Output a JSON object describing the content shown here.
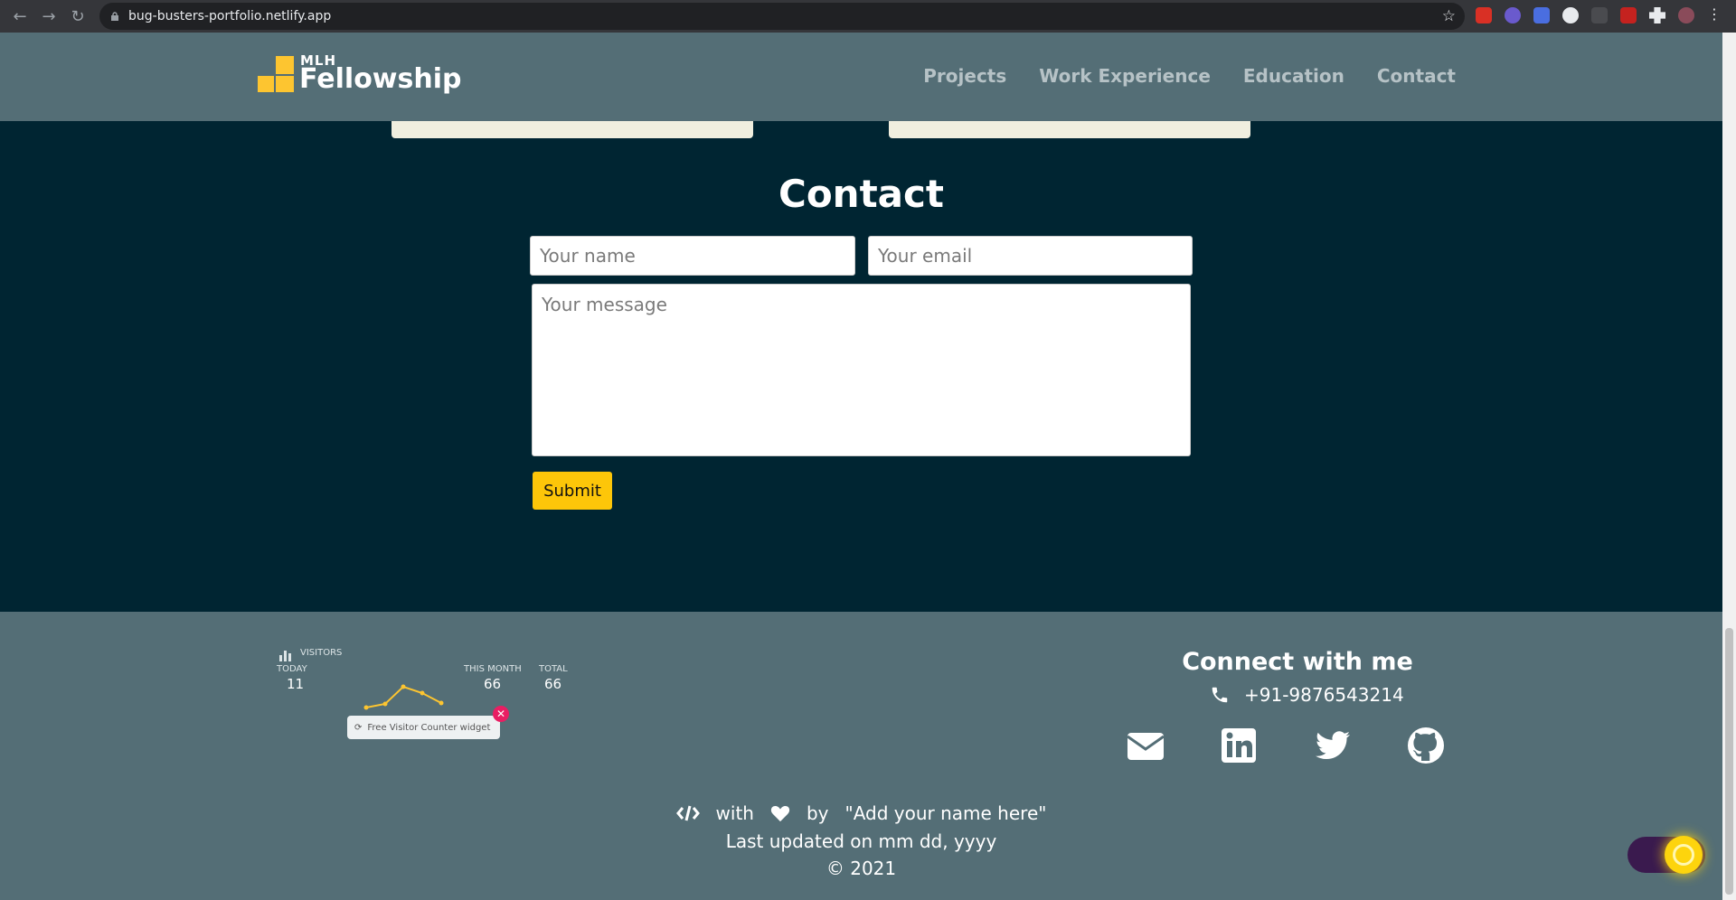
{
  "browser": {
    "url": "bug-busters-portfolio.netlify.app"
  },
  "header": {
    "logo_small": "MLH",
    "logo_large": "Fellowship",
    "nav": [
      {
        "label": "Projects"
      },
      {
        "label": "Work Experience"
      },
      {
        "label": "Education"
      },
      {
        "label": "Contact"
      }
    ]
  },
  "contact": {
    "title": "Contact",
    "name_placeholder": "Your name",
    "email_placeholder": "Your email",
    "message_placeholder": "Your message",
    "submit_label": "Submit"
  },
  "visitor_counter": {
    "heading": "VISITORS",
    "today_label": "TODAY",
    "today_value": "11",
    "month_label": "THIS MONTH",
    "month_value": "66",
    "total_label": "TOTAL",
    "total_value": "66",
    "badge_text": "Free Visitor Counter widget"
  },
  "footer": {
    "connect_title": "Connect with me",
    "phone": "+91-9876543214",
    "social_icons": [
      "envelope-icon",
      "linkedin-icon",
      "twitter-icon",
      "github-icon"
    ],
    "credit_with": "with",
    "credit_by": "by",
    "credit_name": "\"Add your name here\"",
    "updated": "Last updated on mm dd, yyyy",
    "copyright": "© 2021"
  },
  "colors": {
    "page_bg": "#002532",
    "header_bg": "#546e76",
    "accent_yellow": "#fdc609",
    "card_bg": "#f0efdf"
  }
}
